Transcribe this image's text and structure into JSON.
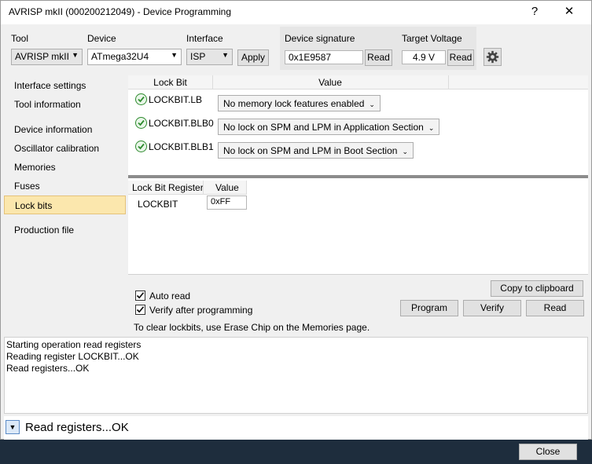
{
  "window": {
    "title": "AVRISP mkII (000200212049) - Device Programming",
    "help_glyph": "?",
    "close_glyph": "✕"
  },
  "toolbar": {
    "tool_label": "Tool",
    "tool_value": "AVRISP mkII",
    "device_label": "Device",
    "device_value": "ATmega32U4",
    "interface_label": "Interface",
    "interface_value": "ISP",
    "apply_label": "Apply",
    "signature_label": "Device signature",
    "signature_value": "0x1E9587",
    "signature_read": "Read",
    "voltage_label": "Target Voltage",
    "voltage_value": "4.9 V",
    "voltage_read": "Read",
    "settings_icon": "gear-icon"
  },
  "nav": {
    "items": [
      {
        "label": "Interface settings"
      },
      {
        "label": "Tool information"
      },
      {
        "label": "Device information"
      },
      {
        "label": "Oscillator calibration"
      },
      {
        "label": "Memories"
      },
      {
        "label": "Fuses"
      },
      {
        "label": "Lock bits"
      },
      {
        "label": "Production file"
      }
    ],
    "selected": "Lock bits"
  },
  "lockbits": {
    "col_lockbit": "Lock Bit",
    "col_value": "Value",
    "rows": [
      {
        "name": "LOCKBIT.LB",
        "value": "No memory lock features enabled"
      },
      {
        "name": "LOCKBIT.BLB0",
        "value": "No lock on SPM and LPM in Application Section"
      },
      {
        "name": "LOCKBIT.BLB1",
        "value": "No lock on SPM and LPM in Boot Section"
      }
    ]
  },
  "registers": {
    "col_register": "Lock Bit Register",
    "col_value": "Value",
    "rows": [
      {
        "name": "LOCKBIT",
        "value": "0xFF"
      }
    ]
  },
  "options": {
    "auto_read_label": "Auto read",
    "auto_read_checked": true,
    "verify_label": "Verify after programming",
    "verify_checked": true,
    "hint": "To clear lockbits, use Erase Chip on the Memories page.",
    "copy_label": "Copy to clipboard",
    "program_label": "Program",
    "verify_button_label": "Verify",
    "read_label": "Read"
  },
  "log": {
    "lines": [
      "Starting operation read registers",
      "Reading register LOCKBIT...OK",
      "Read registers...OK"
    ]
  },
  "status": {
    "text": "Read registers...OK"
  },
  "footer": {
    "close_label": "Close"
  }
}
